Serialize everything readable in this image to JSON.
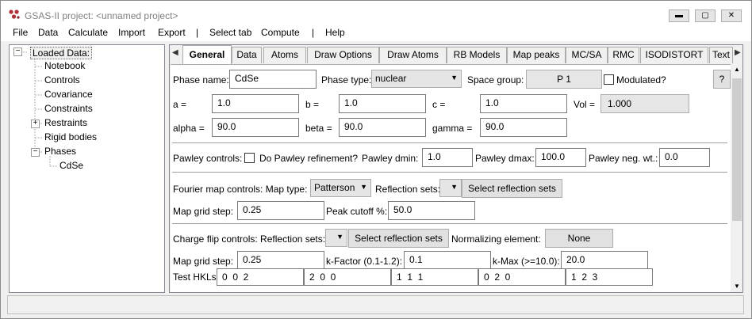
{
  "window": {
    "title": "GSAS-II project: <unnamed project>",
    "min": "▬",
    "max": "▢",
    "close": "✕"
  },
  "menu": [
    "File",
    "Data",
    "Calculate",
    "Import",
    "Export",
    "|",
    "Select tab",
    "Compute",
    "|",
    "Help"
  ],
  "tree": {
    "root": "Loaded Data:",
    "items": [
      "Notebook",
      "Controls",
      "Covariance",
      "Constraints",
      "Restraints",
      "Rigid bodies",
      "Phases"
    ],
    "phase": "CdSe",
    "expander": "+",
    "collapser": "−"
  },
  "tabs": [
    "General",
    "Data",
    "Atoms",
    "Draw Options",
    "Draw Atoms",
    "RB Models",
    "Map peaks",
    "MC/SA",
    "RMC",
    "ISODISTORT",
    "Text"
  ],
  "tab_arrows": {
    "left": "◀",
    "right": "▶"
  },
  "general": {
    "phase_name_label": "Phase name:",
    "phase_name": "CdSe",
    "phase_type_label": "Phase type:",
    "phase_type": "nuclear",
    "space_group_label": "Space group:",
    "space_group": "P 1",
    "modulated_label": "Modulated?",
    "help": "?",
    "a_label": "a =",
    "a": "1.0",
    "b_label": "b =",
    "b": "1.0",
    "c_label": "c =",
    "c": "1.0",
    "vol_label": "Vol =",
    "vol": "1.000",
    "alpha_label": "alpha =",
    "alpha": "90.0",
    "beta_label": "beta =",
    "beta": "90.0",
    "gamma_label": "gamma =",
    "gamma": "90.0",
    "pawley_label": "Pawley controls:",
    "pawley_refine_label": "Do Pawley refinement?",
    "pawley_dmin_label": "Pawley dmin:",
    "pawley_dmin": "1.0",
    "pawley_dmax_label": "Pawley dmax:",
    "pawley_dmax": "100.0",
    "pawley_neg_label": "Pawley neg. wt.:",
    "pawley_neg": "0.0",
    "fourier_label": "Fourier map controls: Map type:",
    "map_type": "Patterson",
    "refl_sets_label": "Reflection sets:",
    "select_refl_button": "Select reflection sets",
    "map_grid_label": "Map grid step:",
    "map_grid": "0.25",
    "peak_cutoff_label": "Peak cutoff %:",
    "peak_cutoff": "50.0",
    "chargeflip_label": "Charge flip controls: Reflection sets:",
    "cf_select_refl_button": "Select reflection sets",
    "norm_elem_label": "Normalizing element:",
    "norm_elem": "None",
    "cf_grid_label": "Map grid step:",
    "cf_grid": "0.25",
    "kfactor_label": "k-Factor (0.1-1.2):",
    "kfactor": "0.1",
    "kmax_label": "k-Max (>=10.0):",
    "kmax": "20.0",
    "test_hkl_label": "Test HKLs:",
    "test_hkls": [
      "0  0  2",
      "2  0  0",
      "1  1  1",
      "0  2  0",
      "1  2  3"
    ]
  },
  "colors": {
    "app_icon": "#b0303a"
  }
}
